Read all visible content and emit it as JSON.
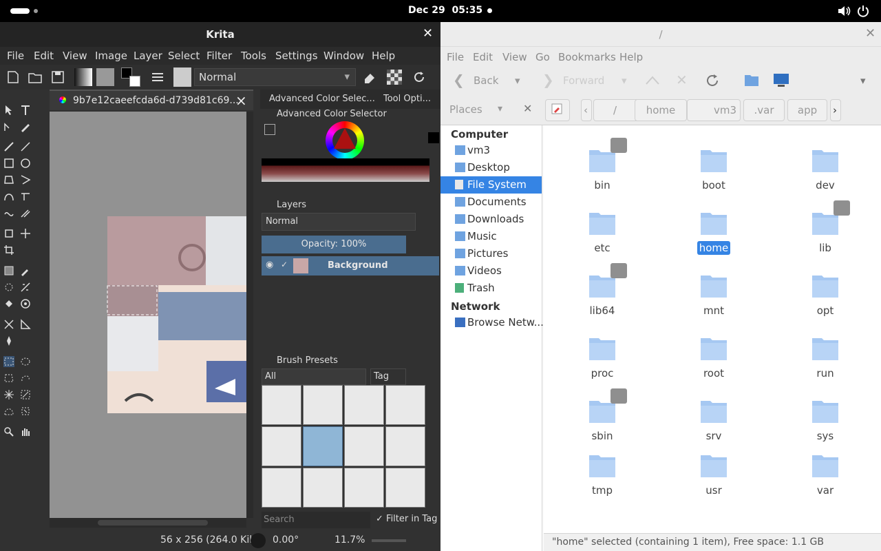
{
  "topbar": {
    "date": "Dec 29",
    "time": "05:35"
  },
  "krita": {
    "title": "Krita",
    "menu": [
      "File",
      "Edit",
      "View",
      "Image",
      "Layer",
      "Select",
      "Filter",
      "Tools",
      "Settings",
      "Window",
      "Help"
    ],
    "blend_mode": "Normal",
    "doc_tab": "9b7e12caeefcda6d-d739d81c69...",
    "dock_tabs": [
      "Advanced Color Selec...",
      "Tool Opti..."
    ],
    "color_selector_title": "Advanced Color Selector",
    "layers_title": "Layers",
    "layers_blend": "Normal",
    "opacity": "Opacity:  100%",
    "layer_name": "Background",
    "brush_presets_title": "Brush Presets",
    "brush_filter": "All",
    "tag_label": "Tag",
    "search_placeholder": "Search",
    "filter_in_tag": "Filter in Tag",
    "status_size": "56 x 256 (264.0 Kil",
    "status_rotation": "0.00°",
    "status_zoom": "11.7%"
  },
  "files": {
    "title": "/",
    "menu": [
      "File",
      "Edit",
      "View",
      "Go",
      "Bookmarks",
      "Help"
    ],
    "back": "Back",
    "forward": "Forward",
    "places": "Places",
    "breadcrumbs": [
      "/",
      "home",
      "vm3",
      ".var",
      "app"
    ],
    "sidebar": {
      "computer_header": "Computer",
      "items": [
        "vm3",
        "Desktop",
        "File System",
        "Documents",
        "Downloads",
        "Music",
        "Pictures",
        "Videos",
        "Trash"
      ],
      "network_header": "Network",
      "network_items": [
        "Browse Netw..."
      ]
    },
    "folders": [
      "bin",
      "boot",
      "dev",
      "etc",
      "home",
      "lib",
      "lib64",
      "mnt",
      "opt",
      "proc",
      "root",
      "run",
      "sbin",
      "srv",
      "sys",
      "tmp",
      "usr",
      "var"
    ],
    "symlinks": [
      "bin",
      "lib",
      "lib64",
      "sbin"
    ],
    "selected": "home",
    "status": "\"home\" selected (containing 1 item), Free space: 1.1 GB"
  },
  "colors": {
    "accent": "#3584e4",
    "folder": "#a6c8f2",
    "krita_bg": "#313131"
  }
}
